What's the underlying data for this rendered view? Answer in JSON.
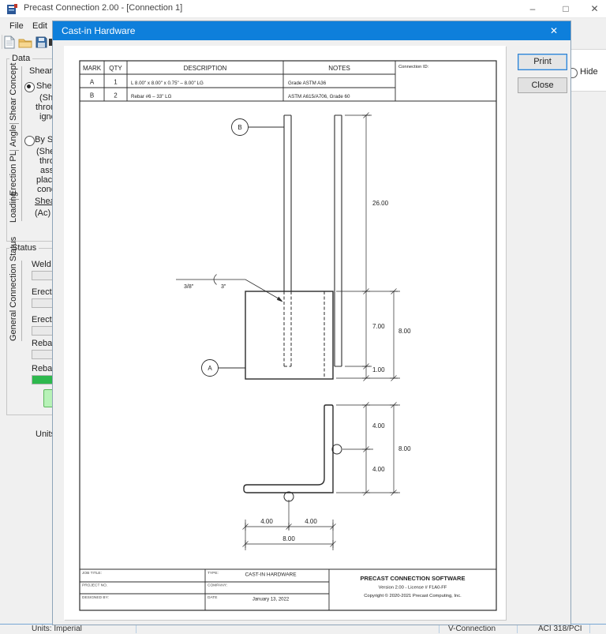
{
  "window": {
    "title": "Precast Connection 2.00 - [Connection 1]",
    "menu": [
      "File",
      "Edit"
    ],
    "minimize_glyph": "–",
    "maximize_glyph": "□",
    "close_glyph": "✕"
  },
  "sidebar": {
    "data_group_title": "Data",
    "tabs": [
      "Shear Concept",
      "Angle",
      "Erection PL",
      "Loading"
    ],
    "lines": [
      "Shear Tr",
      "Shear",
      "(She",
      "through",
      "ignori",
      "By Sh",
      "(Shear",
      "throu",
      "assur",
      "placed",
      "concre",
      "Shear T",
      "(Ac) ="
    ],
    "status_group_title": "Status",
    "status_tab": "General Connection Status",
    "status_items": [
      "Weld U",
      "Erectio",
      "Erectio",
      "Rebar U",
      "Rebar W"
    ],
    "units_label": "Units:"
  },
  "right_panel": {
    "hide_label": "Hide"
  },
  "statusbar": {
    "units": "Units: Imperial",
    "connection": "V-Connection",
    "code": "ACI 318/PCI"
  },
  "colors": {
    "dialog_titlebar": "#0e7fdb",
    "progress_green": "#2db84d",
    "button_green": "#b7f2b7"
  },
  "dialog": {
    "title": "Cast-in Hardware",
    "close_glyph": "✕",
    "print_button": "Print",
    "close_button": "Close",
    "table": {
      "h_mark": "MARK",
      "h_qty": "QTY",
      "h_desc": "DESCRIPTION",
      "h_notes": "NOTES",
      "connection_id_label": "Connection ID:",
      "rows": [
        {
          "mark": "A",
          "qty": "1",
          "desc": "L 8.00\" x 8.00\" x 0.75\" – 8.00\"  LG",
          "notes": "Grade ASTM A36"
        },
        {
          "mark": "B",
          "qty": "2",
          "desc": "Rebar  #6 – 33\" LG",
          "notes": "ASTM A615/A706, Grade 60"
        }
      ]
    },
    "drawing": {
      "balloon_b": "B",
      "balloon_a": "A",
      "weld_size": "3/8\"",
      "weld_length": "3\"",
      "dim_rebar": "26.00",
      "dim_upper": "7.00",
      "dim_lower": "1.00",
      "dim_total": "8.00",
      "dim_av1": "4.00",
      "dim_av2": "4.00",
      "dim_avt": "8.00",
      "dim_ah1": "4.00",
      "dim_ah2": "4.00",
      "dim_aht": "8.00"
    },
    "titleblock": {
      "job_title": "JOB TITLE:",
      "project_no": "PROJECT NO.",
      "designed_by": "DESIGNED BY:",
      "type_label": "TYPE:",
      "type_value": "CAST-IN HARDWARE",
      "company_label": "COMPANY:",
      "date_label": "DATE",
      "date_value": "January 13, 2022",
      "software_name": "PRECAST CONNECTION SOFTWARE",
      "version_line": "Version 2.00 - License # F1A0-FF",
      "copyright_line": "Copyright © 2020-2021 Precast Computing, Inc."
    }
  }
}
